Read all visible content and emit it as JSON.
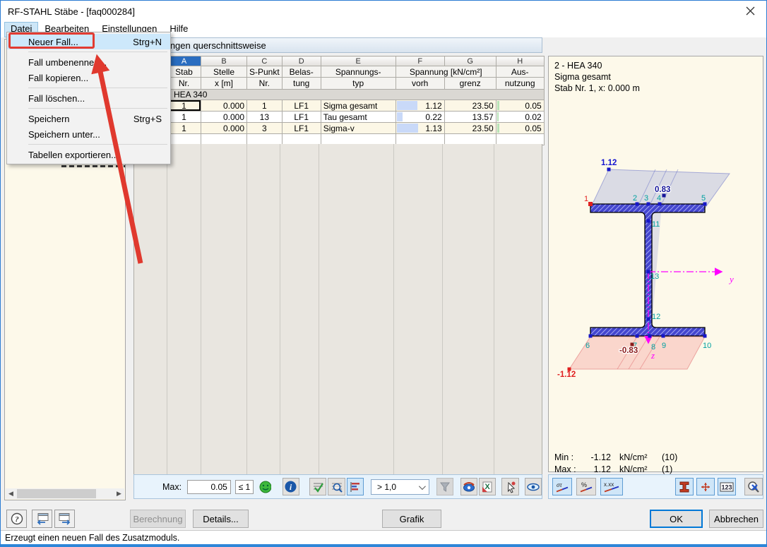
{
  "window": {
    "title": "RF-STAHL Stäbe - [faq000284]"
  },
  "menubar": {
    "items": [
      "Datei",
      "Bearbeiten",
      "Einstellungen",
      "Hilfe"
    ]
  },
  "file_menu": {
    "neuer_fall": "Neuer Fall...",
    "neuer_fall_shortcut": "Strg+N",
    "fall_umbenennen": "Fall umbenennen...",
    "fall_kopieren": "Fall kopieren...",
    "fall_loeschen": "Fall löschen...",
    "speichern": "Speichern",
    "speichern_shortcut": "Strg+S",
    "speichern_unter": "Speichern unter...",
    "tabellen_exportieren": "Tabellen exportieren..."
  },
  "tab": {
    "title": "Spannungen querschnittsweise"
  },
  "table": {
    "letters": [
      "A",
      "B",
      "C",
      "D",
      "E",
      "F",
      "G",
      "H"
    ],
    "header": {
      "stab": "Stab",
      "stab2": "Nr.",
      "stelle": "Stelle",
      "stelle2": "x [m]",
      "spunkt": "S-Punkt",
      "spunkt2": "Nr.",
      "belastung": "Belas-",
      "belastung2": "tung",
      "spannungstyp": "Spannungs-",
      "spannungstyp2": "typ",
      "spannung": "Spannung [kN/cm²]",
      "vorh": "vorh",
      "grenz": "grenz",
      "ausnutzung": "Aus-",
      "ausnutzung2": "nutzung"
    },
    "group_row": "HEA 340",
    "rows": [
      {
        "stab": "1",
        "stelle": "0.000",
        "spunkt": "1",
        "belastung": "LF1",
        "typ": "Sigma gesamt",
        "vorh": "1.12",
        "grenz": "23.50",
        "ausnutzung": "0.05"
      },
      {
        "stab": "1",
        "stelle": "0.000",
        "spunkt": "13",
        "belastung": "LF1",
        "typ": "Tau gesamt",
        "vorh": "0.22",
        "grenz": "13.57",
        "ausnutzung": "0.02"
      },
      {
        "stab": "1",
        "stelle": "0.000",
        "spunkt": "3",
        "belastung": "LF1",
        "typ": "Sigma-v",
        "vorh": "1.13",
        "grenz": "23.50",
        "ausnutzung": "0.05"
      }
    ]
  },
  "table_toolbar": {
    "max_label": "Max:",
    "max_value": "0.05",
    "limit": "≤ 1",
    "filter_value": "> 1,0"
  },
  "graphic": {
    "info_line1": "2 - HEA 340",
    "info_line2": "Sigma gesamt",
    "info_line3": "Stab Nr. 1, x: 0.000 m",
    "labels": {
      "top_value": "1.12",
      "web_top_value": "0.83",
      "web_bottom_value": "-0.83",
      "bottom_value": "-1.12",
      "axis_y": "y",
      "axis_z": "z"
    },
    "points": [
      "1",
      "2",
      "3",
      "4",
      "5",
      "6",
      "7",
      "8",
      "9",
      "10",
      "11",
      "12",
      "13"
    ],
    "min": {
      "label": "Min :",
      "value": "-1.12",
      "unit": "kN/cm²",
      "point": "(10)"
    },
    "max": {
      "label": "Max :",
      "value": "1.12",
      "unit": "kN/cm²",
      "point": "(1)"
    }
  },
  "buttons": {
    "berechnung": "Berechnung",
    "details": "Details...",
    "grafik": "Grafik",
    "ok": "OK",
    "abbrechen": "Abbrechen"
  },
  "statusbar": {
    "text": "Erzeugt einen neuen Fall des Zusatzmoduls."
  },
  "colors": {
    "accent_blue": "#2b7cd3",
    "selection_blue": "#2a6dc0",
    "annotation_red": "#e23b31",
    "bar_blue": "#c9d9f8",
    "tick_green": "#b7e3b7",
    "panel_cream": "#fdf9ea"
  }
}
